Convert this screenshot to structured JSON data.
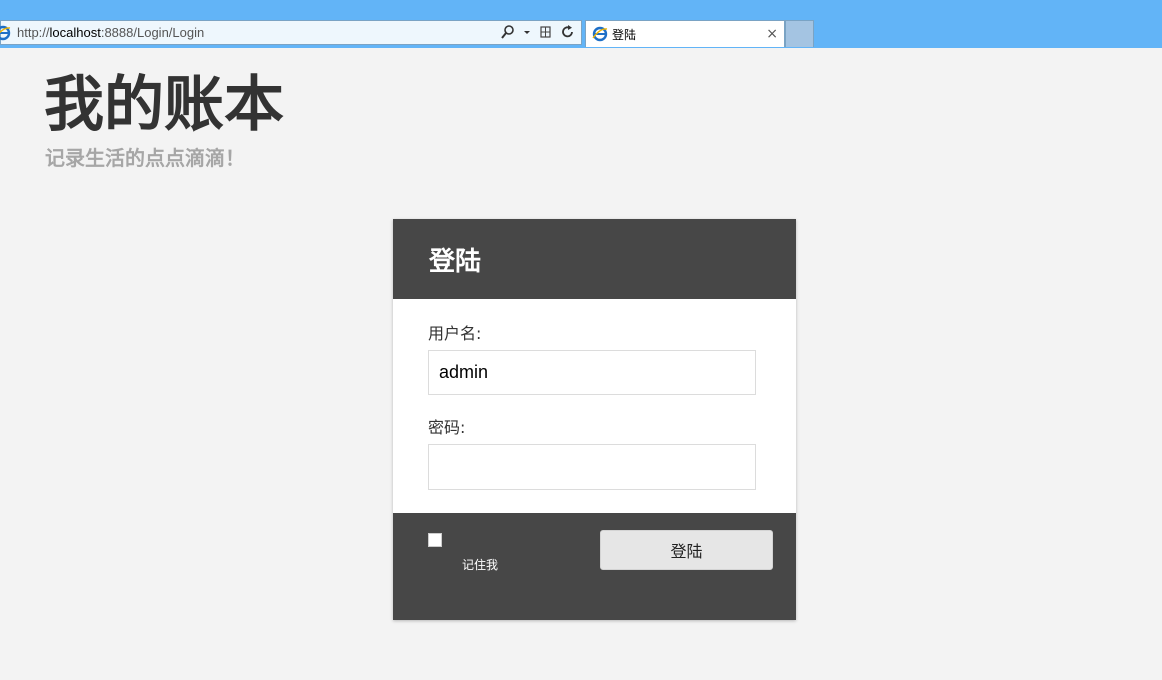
{
  "browser": {
    "url_prefix": "http://",
    "url_host": "localhost",
    "url_rest": ":8888/Login/Login",
    "tab_title": "登陆",
    "tab_close": "×"
  },
  "header": {
    "title": "我的账本",
    "subtitle": "记录生活的点点滴滴！"
  },
  "login": {
    "heading": "登陆",
    "username_label": "用户名:",
    "username_value": "admin",
    "password_label": "密码:",
    "password_value": "",
    "remember_label": "记住我",
    "remember_checked": false,
    "submit_label": "登陆"
  },
  "colors": {
    "chrome": "#62b4f7",
    "panel_dark": "#474747",
    "page_bg": "#f3f3f3",
    "subtitle": "#a6a6a6"
  },
  "icons": [
    "ie-logo-icon",
    "search-icon",
    "dropdown-arrow-icon",
    "compat-view-icon",
    "refresh-icon",
    "close-icon"
  ]
}
